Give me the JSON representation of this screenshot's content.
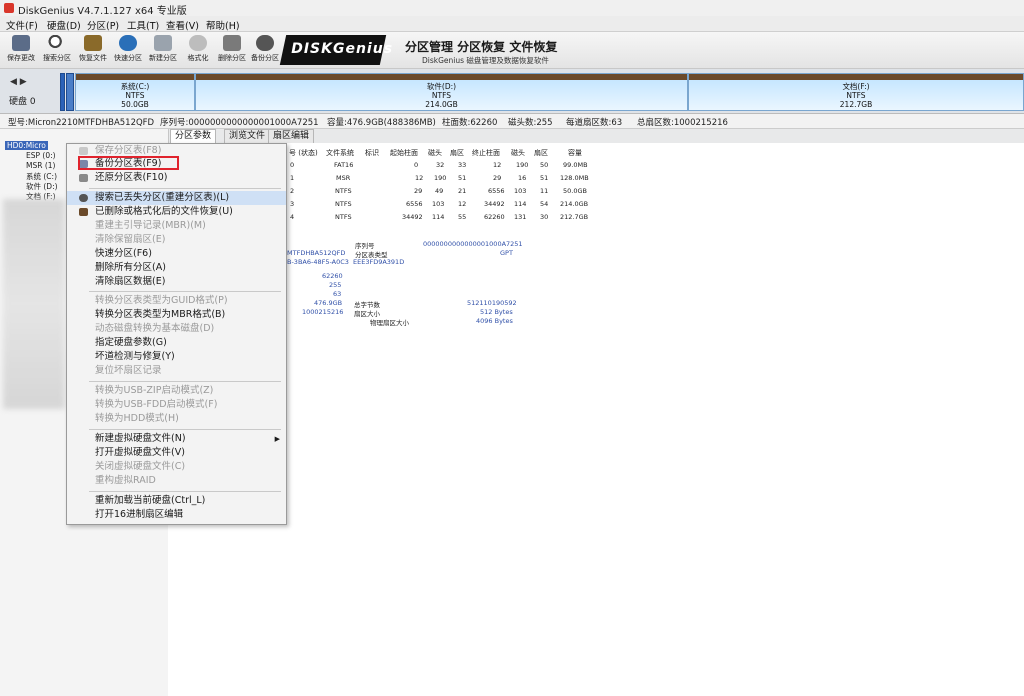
{
  "window": {
    "title": "DiskGenius V4.7.1.127 x64 专业版"
  },
  "menu": [
    "文件(F)",
    "硬盘(D)",
    "分区(P)",
    "工具(T)",
    "查看(V)",
    "帮助(H)"
  ],
  "toolbar": {
    "buttons": [
      {
        "label": "保存更改",
        "icon": "save-icon"
      },
      {
        "label": "搜索分区",
        "icon": "search-icon"
      },
      {
        "label": "恢复文件",
        "icon": "recover-icon"
      },
      {
        "label": "快速分区",
        "icon": "quick-partition-icon"
      },
      {
        "label": "新建分区",
        "icon": "new-partition-icon"
      },
      {
        "label": "格式化",
        "icon": "format-icon"
      },
      {
        "label": "删除分区",
        "icon": "delete-icon"
      },
      {
        "label": "备份分区",
        "icon": "backup-icon"
      }
    ],
    "brand": "DISKGenius",
    "slogan": "分区管理 分区恢复 文件恢复",
    "slogan_sub": "DiskGenius 磁盘管理及数据恢复软件"
  },
  "diskmap": {
    "nav": "◀ ▶",
    "disk_label": "硬盘 0",
    "partitions": [
      {
        "name": "系统(C:)",
        "fs": "NTFS",
        "size": "50.0GB"
      },
      {
        "name": "软件(D:)",
        "fs": "NTFS",
        "size": "214.0GB"
      },
      {
        "name": "文档(F:)",
        "fs": "NTFS",
        "size": "212.7GB"
      }
    ]
  },
  "infobar": {
    "model": "型号:Micron2210MTFDHBA512QFD",
    "serial": "序列号:0000000000000001000A7251",
    "capacity": "容量:476.9GB(488386MB)",
    "cylinders": "柱面数:62260",
    "heads": "磁头数:255",
    "sectors_per_track": "每道扇区数:63",
    "total_sectors": "总扇区数:1000215216"
  },
  "tree": [
    "HD0:Micro",
    "ESP (0:)",
    "MSR (1)",
    "系统 (C:)",
    "软件 (D:)",
    "文档 (F:)"
  ],
  "tabs": [
    "分区参数",
    "浏览文件",
    "扇区编辑"
  ],
  "table": {
    "headers": [
      "号 (状态)",
      "文件系统",
      "标识",
      "起始柱面",
      "磁头",
      "扇区",
      "终止柱面",
      "磁头",
      "扇区",
      "容量"
    ],
    "rows": [
      [
        "0",
        "FAT16",
        "",
        "0",
        "32",
        "33",
        "12",
        "190",
        "50",
        "99.0MB"
      ],
      [
        "1",
        "MSR",
        "",
        "12",
        "190",
        "51",
        "29",
        "16",
        "51",
        "128.0MB"
      ],
      [
        "2",
        "NTFS",
        "",
        "29",
        "49",
        "21",
        "6556",
        "103",
        "11",
        "50.0GB"
      ],
      [
        "3",
        "NTFS",
        "",
        "6556",
        "103",
        "12",
        "34492",
        "114",
        "54",
        "214.0GB"
      ],
      [
        "4",
        "NTFS",
        "",
        "34492",
        "114",
        "55",
        "62260",
        "131",
        "30",
        "212.7GB"
      ]
    ]
  },
  "details": {
    "model_short": "MTFDHBA512QFD",
    "guid": "B-3BA6-48F5-A0C3",
    "serial_label": "序列号",
    "serial_value": "0000000000000001000A7251",
    "ptype_label": "分区表类型",
    "ptype_value": "GPT",
    "guid2": "EEE3FD9A391D",
    "cyl": "62260",
    "heads": "255",
    "spt": "63",
    "capacity": "476.9GB",
    "total_sectors": "1000215216",
    "total_bytes_label": "总字节数",
    "total_bytes_value": "512110190592",
    "sector_size_label": "扇区大小",
    "sector_size_value": "512 Bytes",
    "phys_sector_label": "物理扇区大小",
    "phys_sector_value": "4096 Bytes"
  },
  "context_menu": [
    {
      "label": "保存分区表(F8)",
      "enabled": false
    },
    {
      "label": "备份分区表(F9)",
      "enabled": true,
      "highlight": "boxed"
    },
    {
      "label": "还原分区表(F10)",
      "enabled": true
    },
    {
      "sep": true
    },
    {
      "label": "搜索已丢失分区(重建分区表)(L)",
      "enabled": true,
      "hover": true
    },
    {
      "label": "已删除或格式化后的文件恢复(U)",
      "enabled": true
    },
    {
      "label": "重建主引导记录(MBR)(M)",
      "enabled": false
    },
    {
      "label": "清除保留扇区(E)",
      "enabled": false
    },
    {
      "label": "快速分区(F6)",
      "enabled": true
    },
    {
      "label": "删除所有分区(A)",
      "enabled": true
    },
    {
      "label": "清除扇区数据(E)",
      "enabled": true
    },
    {
      "sep": true
    },
    {
      "label": "转换分区表类型为GUID格式(P)",
      "enabled": false
    },
    {
      "label": "转换分区表类型为MBR格式(B)",
      "enabled": true
    },
    {
      "label": "动态磁盘转换为基本磁盘(D)",
      "enabled": false
    },
    {
      "label": "指定硬盘参数(G)",
      "enabled": true
    },
    {
      "label": "坏道检测与修复(Y)",
      "enabled": true
    },
    {
      "label": "复位坏扇区记录",
      "enabled": false
    },
    {
      "sep": true
    },
    {
      "label": "转换为USB-ZIP启动模式(Z)",
      "enabled": false
    },
    {
      "label": "转换为USB-FDD启动模式(F)",
      "enabled": false
    },
    {
      "label": "转换为HDD模式(H)",
      "enabled": false
    },
    {
      "sep": true
    },
    {
      "label": "新建虚拟硬盘文件(N)",
      "enabled": true,
      "submenu": true
    },
    {
      "label": "打开虚拟硬盘文件(V)",
      "enabled": true
    },
    {
      "label": "关闭虚拟硬盘文件(C)",
      "enabled": false
    },
    {
      "label": "重构虚拟RAID",
      "enabled": false
    },
    {
      "sep": true
    },
    {
      "label": "重新加载当前硬盘(Ctrl_L)",
      "enabled": true
    },
    {
      "label": "打开16进制扇区编辑",
      "enabled": true
    }
  ],
  "colors": {
    "accent_red": "#e0232d",
    "partition_bar": "#6b4a2a",
    "esp_blue": "#2b62b8"
  }
}
